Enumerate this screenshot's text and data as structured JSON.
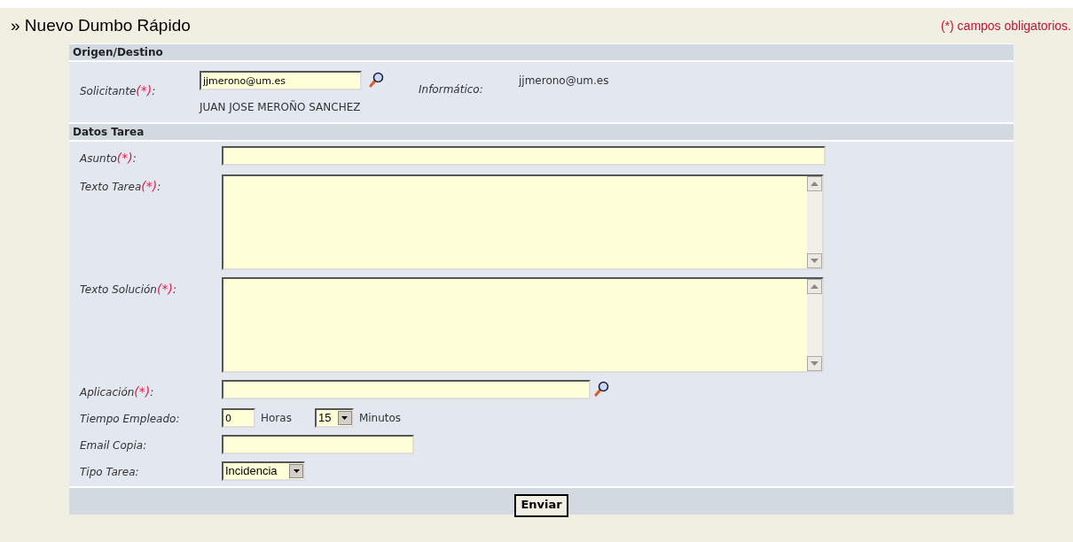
{
  "title": "» Nuevo Dumbo Rápido",
  "required_note": "(*) campos obligatorios.",
  "origen": {
    "heading": "Origen/Destino",
    "solicitante": {
      "label": "Solicitante",
      "mark": "(*)",
      "colon": ":",
      "value": "jjmerono@um.es",
      "name": "JUAN JOSE MEROÑO SANCHEZ"
    },
    "informatico": {
      "label": "Informático:",
      "value": "jjmerono@um.es"
    }
  },
  "datos": {
    "heading": "Datos Tarea",
    "rows": [
      {
        "kind": "input",
        "label": "Asunto",
        "mark": "(*)",
        "colon": ":",
        "value": ""
      },
      {
        "kind": "textarea",
        "label": "Texto Tarea",
        "mark": "(*)",
        "colon": ":",
        "value": ""
      },
      {
        "kind": "textarea",
        "label": "Texto Solución",
        "mark": "(*)",
        "colon": ":",
        "value": ""
      },
      {
        "kind": "lookup",
        "label": "Aplicación",
        "mark": "(*)",
        "colon": ":",
        "value": ""
      },
      {
        "kind": "time",
        "label": "Tiempo Empleado:",
        "hours": "0",
        "hours_label": "Horas",
        "minutes": "15",
        "minutes_label": "Minutos"
      },
      {
        "kind": "email",
        "label": "Email Copia:",
        "value": ""
      },
      {
        "kind": "select",
        "label": "Tipo Tarea:",
        "value": "Incidencia"
      }
    ]
  },
  "submit": "Enviar"
}
